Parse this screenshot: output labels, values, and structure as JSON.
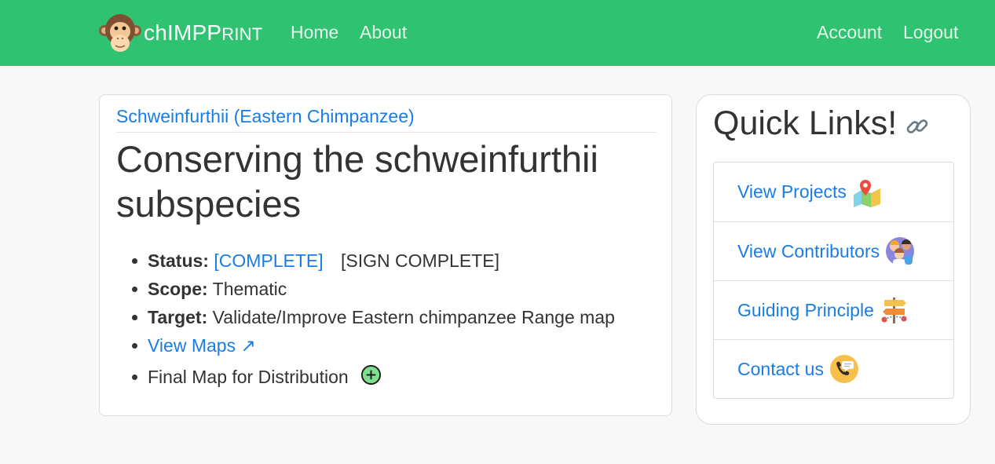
{
  "navbar": {
    "brand_prefix": "chIMP",
    "brand_suffix": "RINT",
    "brand_initial": "P",
    "links_left": [
      {
        "label": "Home"
      },
      {
        "label": "About"
      }
    ],
    "links_right": [
      {
        "label": "Account"
      },
      {
        "label": "Logout"
      }
    ],
    "colors": {
      "bar": "#2fc270",
      "link": "#e4f5ea"
    }
  },
  "project": {
    "header_link": "Schweinfurthii (Eastern Chimpanzee)",
    "title": "Conserving the schweinfurthii subspecies",
    "status_label": "Status:",
    "status_value": "[COMPLETE]",
    "status_action": "[SIGN COMPLETE]",
    "scope_label": "Scope:",
    "scope_value": "Thematic",
    "target_label": "Target:",
    "target_value": "Validate/Improve Eastern chimpanzee Range map",
    "view_maps": "View Maps ↗",
    "final_map": "Final Map for Distribution",
    "final_map_icon": "add-circle-icon"
  },
  "quick_links": {
    "title": "Quick Links!",
    "title_icon": "chain-link-icon",
    "items": [
      {
        "label": "View Projects",
        "icon": "map-pin-icon"
      },
      {
        "label": "View Contributors",
        "icon": "people-icon"
      },
      {
        "label": "Guiding Principle",
        "icon": "signpost-icon"
      },
      {
        "label": "Contact us",
        "icon": "phone-chat-icon"
      }
    ]
  },
  "colors": {
    "link": "#1a7de3",
    "text": "#333333",
    "background": "#f8f8f8"
  }
}
